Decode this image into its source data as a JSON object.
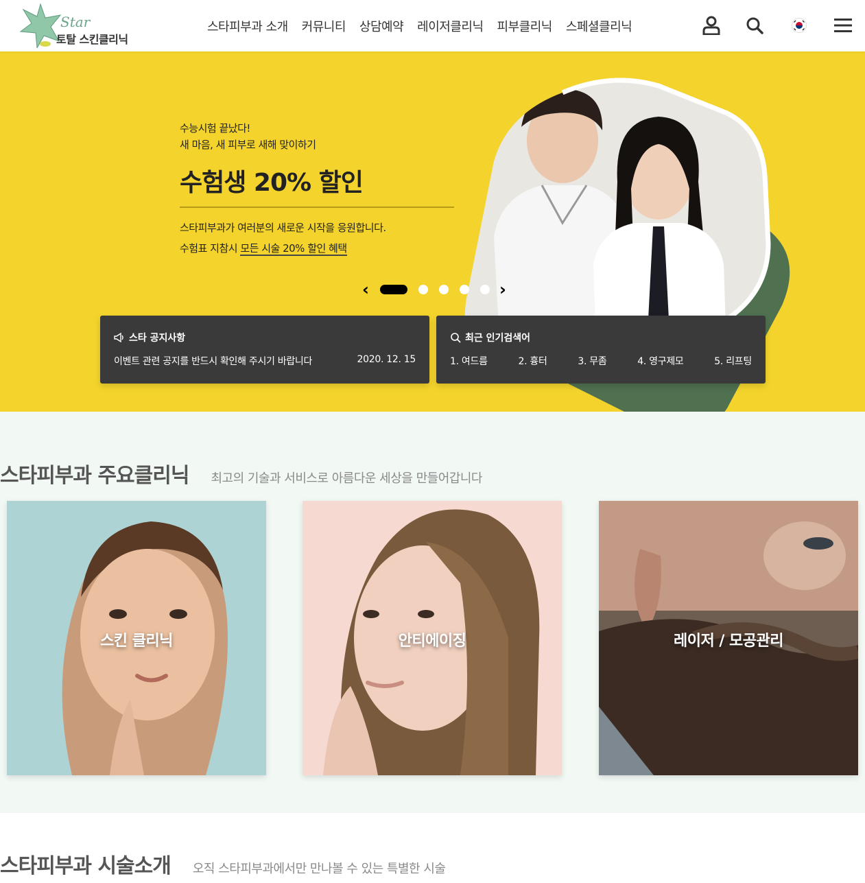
{
  "header": {
    "logo_en": "Star",
    "logo_ko": "토탈 스킨클리닉",
    "nav": [
      "스타피부과 소개",
      "커뮤니티",
      "상담예약",
      "레이저클리닉",
      "피부클리닉",
      "스페셜클리닉"
    ],
    "icons": [
      "user-icon",
      "search-icon",
      "korea-flag-icon",
      "menu-icon"
    ]
  },
  "hero": {
    "line1": "수능시험 끝났다!",
    "line2": "새 마음, 새 피부로 새해 맞이하기",
    "title": "수험생 20% 할인",
    "desc1": "스타피부과가 여러분의 새로운 시작을 응원합니다.",
    "desc2_prefix": "수험표 지참시 ",
    "desc2_emph": "모든 시술 20% 할인 혜택",
    "slides_total": 5,
    "slide_active": 1
  },
  "notice": {
    "title": "스타 공지사항",
    "text": "이벤트 관련 공지를 반드시 확인해 주시기 바랍니다",
    "date": "2020. 12. 15"
  },
  "popular": {
    "title": "최근 인기검색어",
    "items": [
      "1. 여드름",
      "2. 흉터",
      "3. 무좀",
      "4. 영구제모",
      "5. 리프팅"
    ]
  },
  "clinic": {
    "title": "스타피부과 주요클리닉",
    "subtitle": "최고의 기술과 서비스로 아름다운 세상을 만들어갑니다",
    "cards": [
      "스킨 클리닉",
      "안티에이징",
      "레이저 / 모공관리"
    ]
  },
  "treatment": {
    "title": "스타피부과 시술소개",
    "subtitle": "오직 스타피부과에서만 만나볼 수 있는 특별한 시술"
  },
  "colors": {
    "hero_bg": "#f4d42c",
    "panel_bg": "#3a3a3a",
    "section_bg": "#f2f8f4",
    "accent_green": "#4f7150"
  }
}
